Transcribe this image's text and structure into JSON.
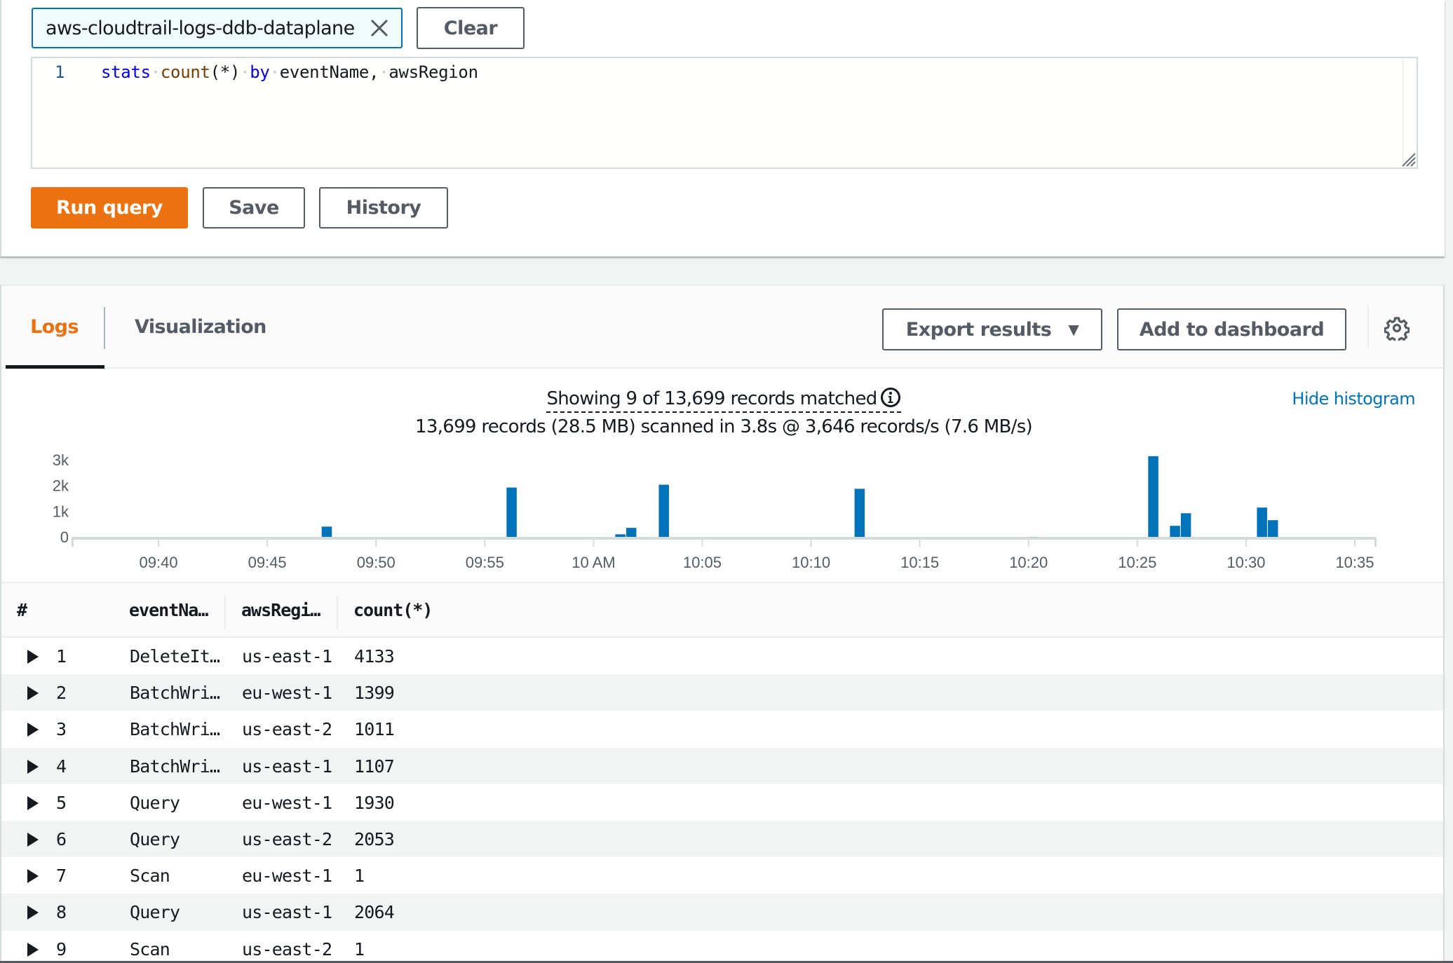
{
  "query": {
    "log_group_chip": "aws-cloudtrail-logs-ddb-dataplane",
    "clear_label": "Clear",
    "editor": {
      "line_number": "1",
      "tokens": {
        "t1": "stats",
        "t2": "count",
        "t3": "(*)",
        "t4": "by",
        "t5": "eventName,",
        "t6": "awsRegion"
      }
    },
    "run_label": "Run query",
    "save_label": "Save",
    "history_label": "History"
  },
  "results": {
    "tabs": [
      {
        "label": "Logs",
        "active": true
      },
      {
        "label": "Visualization",
        "active": false
      }
    ],
    "export_label": "Export results",
    "dashboard_label": "Add to dashboard",
    "summary_matched": "Showing 9 of 13,699 records matched",
    "summary_scanned": "13,699 records (28.5 MB) scanned in 3.8s @ 3,646 records/s (7.6 MB/s)",
    "hide_histogram_label": "Hide histogram",
    "bar_color": "#0073bb",
    "accent_color": "#ec7211"
  },
  "chart_data": {
    "type": "bar",
    "title": "",
    "xlabel": "",
    "ylabel": "",
    "y_ticks": [
      "0",
      "1k",
      "2k",
      "3k"
    ],
    "ylim": [
      0,
      3000
    ],
    "x_range": [
      "09:36",
      "10:36"
    ],
    "x_ticks": [
      "09:40",
      "09:45",
      "09:50",
      "09:55",
      "10 AM",
      "10:05",
      "10:10",
      "10:15",
      "10:20",
      "10:25",
      "10:30",
      "10:35"
    ],
    "bin_seconds": 30,
    "bins": [
      {
        "time": "09:47:30",
        "value": 400
      },
      {
        "time": "09:56:00",
        "value": 1920
      },
      {
        "time": "10:01:00",
        "value": 100
      },
      {
        "time": "10:01:30",
        "value": 350
      },
      {
        "time": "10:03:00",
        "value": 2030
      },
      {
        "time": "10:12:00",
        "value": 1870
      },
      {
        "time": "10:20:00",
        "value": 2
      },
      {
        "time": "10:25:30",
        "value": 3140
      },
      {
        "time": "10:26:30",
        "value": 430
      },
      {
        "time": "10:27:00",
        "value": 920
      },
      {
        "time": "10:30:30",
        "value": 1140
      },
      {
        "time": "10:31:00",
        "value": 650
      }
    ],
    "grid": false,
    "legend": "none"
  },
  "table": {
    "columns": [
      "#",
      "eventNa…",
      "awsRegi…",
      "count(*)"
    ],
    "rows": [
      {
        "idx": "1",
        "eventName": "DeleteIt…",
        "awsRegion": "us-east-1",
        "count": "4133"
      },
      {
        "idx": "2",
        "eventName": "BatchWri…",
        "awsRegion": "eu-west-1",
        "count": "1399"
      },
      {
        "idx": "3",
        "eventName": "BatchWri…",
        "awsRegion": "us-east-2",
        "count": "1011"
      },
      {
        "idx": "4",
        "eventName": "BatchWri…",
        "awsRegion": "us-east-1",
        "count": "1107"
      },
      {
        "idx": "5",
        "eventName": "Query",
        "awsRegion": "eu-west-1",
        "count": "1930"
      },
      {
        "idx": "6",
        "eventName": "Query",
        "awsRegion": "us-east-2",
        "count": "2053"
      },
      {
        "idx": "7",
        "eventName": "Scan",
        "awsRegion": "eu-west-1",
        "count": "1"
      },
      {
        "idx": "8",
        "eventName": "Query",
        "awsRegion": "us-east-1",
        "count": "2064"
      },
      {
        "idx": "9",
        "eventName": "Scan",
        "awsRegion": "us-east-2",
        "count": "1"
      }
    ]
  },
  "icons": {
    "chip_close": "close-x-icon",
    "export_caret": "caret-down-icon",
    "settings": "gear-icon",
    "info": "info-icon",
    "row_expand": "triangle-right-icon",
    "editor_resize": "resize-grip-icon"
  }
}
